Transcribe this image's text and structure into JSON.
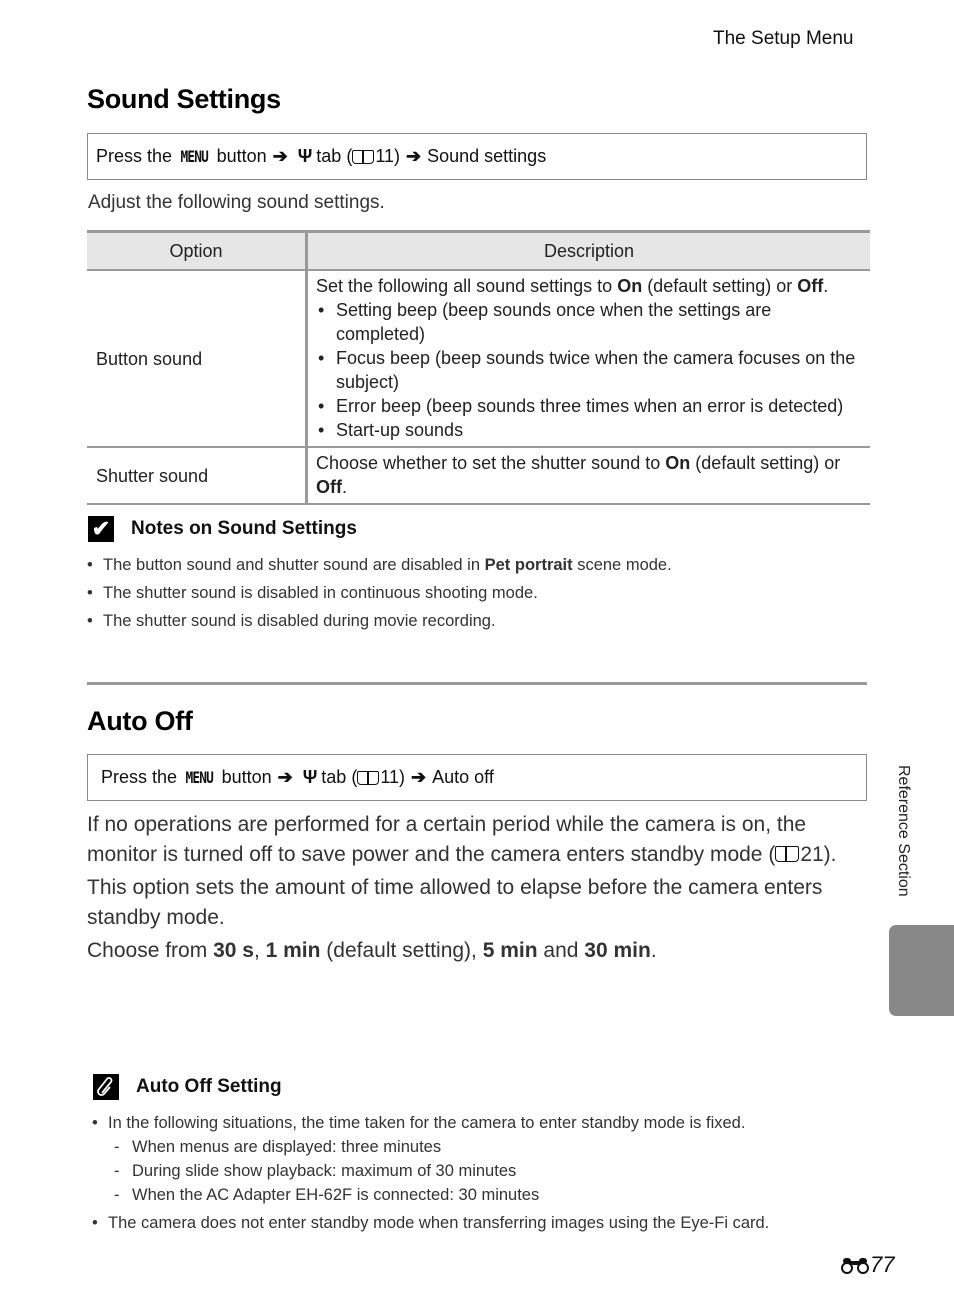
{
  "header": {
    "section_title": "The Setup Menu"
  },
  "sound_settings": {
    "title": "Sound Settings",
    "nav": {
      "prefix": "Press the",
      "menu_word": "MENU",
      "button_word": "button",
      "tab_word": "tab (",
      "page_ref": "11)",
      "destination": "Sound settings"
    },
    "intro": "Adjust the following sound settings.",
    "table": {
      "headers": [
        "Option",
        "Description"
      ],
      "rows": [
        {
          "option": "Button sound",
          "desc_pre": "Set the following all sound settings to ",
          "desc_on": "On",
          "desc_mid": " (default setting) or ",
          "desc_off": "Off",
          "desc_end": ".",
          "bullets": [
            "Setting beep (beep sounds once when the settings are completed)",
            "Focus beep (beep sounds twice when the camera focuses on the subject)",
            "Error beep (beep sounds three times when an error is detected)",
            "Start-up sounds"
          ]
        },
        {
          "option": "Shutter sound",
          "desc_pre": "Choose whether to set the shutter sound to ",
          "desc_on": "On",
          "desc_mid": " (default setting) or ",
          "desc_off": "Off",
          "desc_end": "."
        }
      ]
    },
    "notes": {
      "title": "Notes on Sound Settings",
      "icon": "checkmark-icon",
      "items": [
        {
          "pre": "The button sound and shutter sound are disabled in ",
          "bold": "Pet portrait",
          "post": " scene mode."
        },
        {
          "pre": "The shutter sound is disabled  in continuous shooting mode.",
          "bold": "",
          "post": ""
        },
        {
          "pre": "The shutter sound is disabled during movie recording.",
          "bold": "",
          "post": ""
        }
      ]
    }
  },
  "auto_off": {
    "title": "Auto Off",
    "nav": {
      "prefix": "Press the",
      "menu_word": "MENU",
      "button_word": "button",
      "tab_word": "tab (",
      "page_ref": "11)",
      "destination": "Auto off"
    },
    "para1_line1": "If no operations are performed for a certain period while the camera is on, the",
    "para1_line2_pre": "monitor is turned off to save power and the camera enters standby mode (",
    "para1_line2_ref": "21).",
    "para2": "This option sets the amount of time allowed to elapse before the camera enters standby mode.",
    "choose": {
      "pre": "Choose from ",
      "opt1": "30 s",
      "sep1": ", ",
      "opt2": "1 min",
      "mid": " (default setting), ",
      "opt3": "5 min",
      "and": " and ",
      "opt4": "30 min",
      "end": "."
    },
    "note": {
      "title": "Auto Off Setting",
      "icon": "paperclip-icon",
      "item1": "In the following situations, the time taken for the camera to enter standby mode is fixed.",
      "sub_items": [
        "When menus are displayed: three minutes",
        "During slide show playback: maximum of 30 minutes",
        "When the AC Adapter EH-62F is connected: 30 minutes"
      ],
      "item2": "The camera does not enter standby mode when transferring images using the Eye-Fi card."
    }
  },
  "side_tab": {
    "label": "Reference Section"
  },
  "footer": {
    "page_number": "77",
    "page_icon": "binoculars-icon"
  }
}
